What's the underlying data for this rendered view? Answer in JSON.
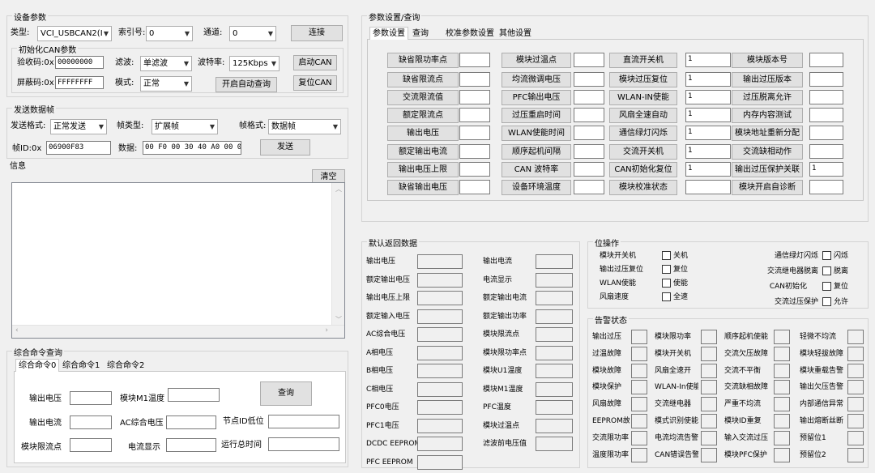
{
  "device": {
    "title": "设备参数",
    "type_lbl": "类型:",
    "type_val": "VCI_USBCAN2(I",
    "index_lbl": "索引号:",
    "index_val": "0",
    "chan_lbl": "通道:",
    "chan_val": "0",
    "connect": "连接",
    "init_title": "初始化CAN参数",
    "acc_lbl": "验收码:0x",
    "acc_val": "00000000",
    "filter_lbl": "滤波:",
    "filter_val": "单滤波",
    "baud_lbl": "波特率:",
    "baud_val": "125Kbps",
    "start_can": "启动CAN",
    "mask_lbl": "屏蔽码:0x",
    "mask_val": "FFFFFFFF",
    "mode_lbl": "模式:",
    "mode_val": "正常",
    "auto_query": "开启自动查询",
    "reset_can": "复位CAN"
  },
  "send": {
    "title": "发送数据帧",
    "fmt_lbl": "发送格式:",
    "fmt_val": "正常发送",
    "ftype_lbl": "帧类型:",
    "ftype_val": "扩展帧",
    "fform_lbl": "帧格式:",
    "fform_val": "数据帧",
    "id_lbl": "帧ID:0x",
    "id_val": "06900F83",
    "data_lbl": "数据:",
    "data_val": "00 F0 00 30 40 A0 00 00",
    "send_btn": "发送"
  },
  "info": {
    "title": "信息",
    "clear": "清空"
  },
  "cmd": {
    "title": "综合命令查询",
    "tabs": [
      "综合命令0",
      "综合命令1",
      "综合命令2"
    ],
    "query": "查询",
    "labels": [
      "输出电压",
      "模块M1温度",
      "输出电流",
      "AC综合电压",
      "节点ID低位",
      "模块限流点",
      "电流显示",
      "运行总时间"
    ]
  },
  "params": {
    "title": "参数设置/查询",
    "tabs": [
      "参数设置",
      "查询",
      "校准参数设置",
      "其他设置"
    ],
    "col1": [
      "缺省限功率点",
      "缺省限流点",
      "交流限流值",
      "额定限流点",
      "输出电压",
      "额定输出电流",
      "输出电压上限",
      "缺省输出电压"
    ],
    "col2": [
      "模块过温点",
      "均流微调电压",
      "PFC输出电压",
      "过压重启时间",
      "WLAN使能时间",
      "顺序起机间隔",
      "CAN 波特率",
      "设备环境温度"
    ],
    "col3": [
      "直流开关机",
      "模块过压复位",
      "WLAN-IN使能",
      "风扇全速自动",
      "通信绿灯闪烁",
      "交流开关机",
      "CAN初始化复位",
      "模块校准状态"
    ],
    "col3_vals": [
      "1",
      "1",
      "1",
      "1",
      "1",
      "1",
      "1"
    ],
    "col4": [
      "模块版本号",
      "输出过压版本",
      "过压脱离允许",
      "内存内容测试",
      "模块地址重新分配",
      "交流缺相动作",
      "输出过压保护关联",
      "模块开启自诊断"
    ],
    "col4_val": "1"
  },
  "ret": {
    "title": "默认返回数据",
    "left": [
      "输出电压",
      "额定输出电压",
      "输出电压上限",
      "额定输入电压",
      "AC综合电压",
      "A相电压",
      "B相电压",
      "C相电压",
      "PFC0电压",
      "PFC1电压",
      "DCDC EEPROM",
      "PFC EEPROM"
    ],
    "right": [
      "输出电流",
      "电流显示",
      "额定输出电流",
      "额定输出功率",
      "模块限流点",
      "模块限功率点",
      "模块U1温度",
      "模块M1温度",
      "PFC温度",
      "模块过温点",
      "滤波前电压值"
    ]
  },
  "bitop": {
    "title": "位操作",
    "rows": [
      [
        "模块开关机",
        "关机"
      ],
      [
        "输出过压复位",
        "复位"
      ],
      [
        "WLAN使能",
        "使能"
      ],
      [
        "风扇速度",
        "全速"
      ]
    ],
    "rrows": [
      [
        "通信绿灯闪烁",
        "闪烁"
      ],
      [
        "交流继电器脱离",
        "脱离"
      ],
      [
        "CAN初始化",
        "复位"
      ],
      [
        "交流过压保护",
        "允许"
      ]
    ]
  },
  "alarm": {
    "title": "告警状态",
    "cols": [
      [
        "输出过压",
        "过温故障",
        "模块故障",
        "模块保护",
        "风扇故障",
        "EEPROM故障",
        "交流限功率",
        "温度限功率"
      ],
      [
        "模块限功率",
        "模块开关机",
        "风扇全速开",
        "WLAN-In使能",
        "交流继电器",
        "模式识别使能",
        "电流均流告警",
        "CAN错误告警"
      ],
      [
        "顺序起机使能",
        "交流欠压故障",
        "交流不平衡",
        "交流缺相故障",
        "严重不均流",
        "模块ID重复",
        "输入交流过压",
        "模块PFC保护"
      ],
      [
        "轻微不均流",
        "模块轻拔故障",
        "模块重载告警",
        "输出欠压告警",
        "内部通信异常",
        "输出熔断丝断",
        "预留位1",
        "预留位2"
      ]
    ]
  }
}
